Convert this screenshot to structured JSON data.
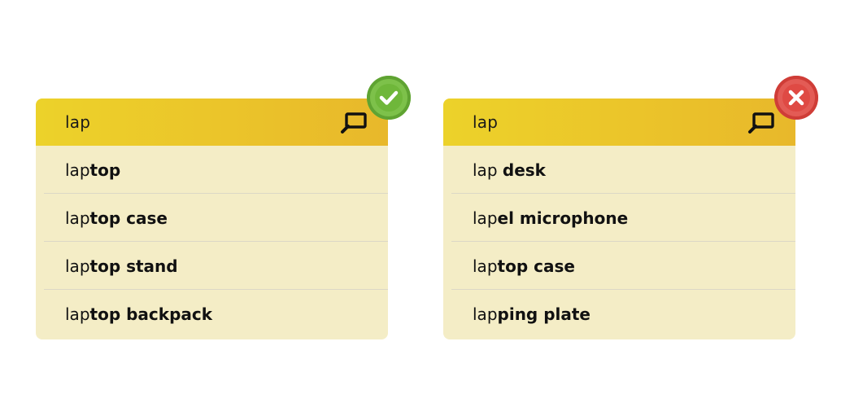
{
  "examples": [
    {
      "verdict": "good",
      "badge_icon": "check-icon",
      "badge_color": "#7dc14a",
      "query": "lap",
      "suggestions": [
        {
          "typed": "lap",
          "rest": "top"
        },
        {
          "typed": "lap",
          "rest": "top case"
        },
        {
          "typed": "lap",
          "rest": "top stand"
        },
        {
          "typed": "lap",
          "rest": "top backpack"
        }
      ]
    },
    {
      "verdict": "bad",
      "badge_icon": "close-icon",
      "badge_color": "#e35b55",
      "query": "lap",
      "suggestions": [
        {
          "typed": "lap ",
          "rest": "desk"
        },
        {
          "typed": "lap",
          "rest": "el microphone"
        },
        {
          "typed": "lap",
          "rest": "top case"
        },
        {
          "typed": "lap",
          "rest": "ping plate"
        }
      ]
    }
  ],
  "colors": {
    "search_bar_gradient_start": "#ecd22a",
    "search_bar_gradient_end": "#e8b82b",
    "suggestion_background": "#f4edc6"
  }
}
